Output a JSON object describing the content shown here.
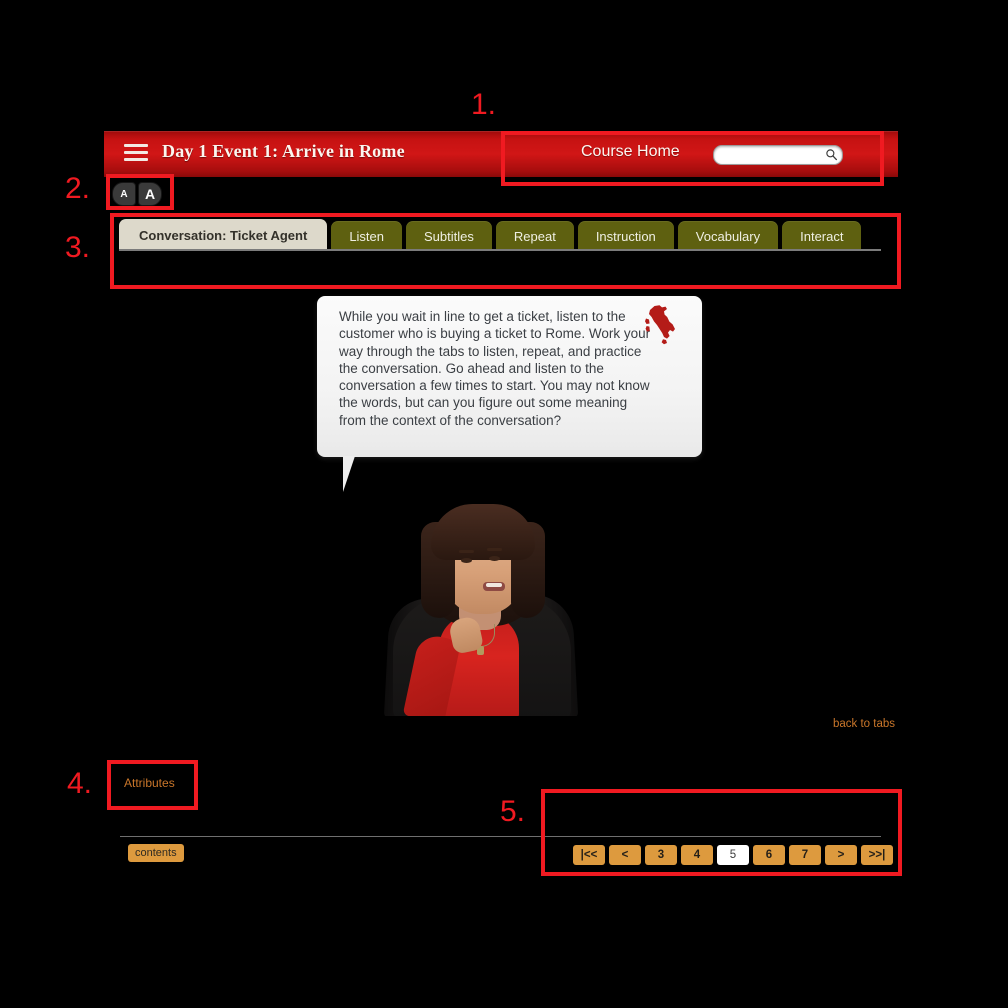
{
  "header": {
    "menu_icon": "hamburger-icon",
    "title": "Day 1 Event 1: Arrive in Rome",
    "course_home_label": "Course Home",
    "search": {
      "value": "",
      "placeholder": "",
      "icon": "search-icon"
    },
    "accent_red": "#c61212"
  },
  "font_size_controls": {
    "decrease_label": "A",
    "increase_label": "A"
  },
  "tabs": [
    {
      "label": "Conversation: Ticket Agent",
      "active": true
    },
    {
      "label": "Listen",
      "active": false
    },
    {
      "label": "Subtitles",
      "active": false
    },
    {
      "label": "Repeat",
      "active": false
    },
    {
      "label": "Instruction",
      "active": false
    },
    {
      "label": "Vocabulary",
      "active": false
    },
    {
      "label": "Interact",
      "active": false
    }
  ],
  "tab_colors": {
    "inactive_bg": "#5e6010",
    "active_bg": "#ddd9cb"
  },
  "bubble": {
    "text": "While you wait in line to get a ticket, listen to the customer who is buying a ticket to Rome. Work your way through the tabs to listen, repeat, and practice the conversation. Go ahead and listen to the conversation a few times to start. You may not know the words, but can you figure out some meaning from the context of the conversation?",
    "icon": "italy-map-icon",
    "icon_color": "#b41c18"
  },
  "presenter": {
    "alt": "woman presenter in red top and black cardigan"
  },
  "links": {
    "back_to_tabs": "back to tabs",
    "attributes": "Attributes",
    "contents": "contents",
    "link_color": "#c9762a"
  },
  "pagination": {
    "current": "5",
    "buttons": [
      {
        "label": "|<<",
        "current": false
      },
      {
        "label": "<",
        "current": false
      },
      {
        "label": "3",
        "current": false
      },
      {
        "label": "4",
        "current": false
      },
      {
        "label": "5",
        "current": true
      },
      {
        "label": "6",
        "current": false
      },
      {
        "label": "7",
        "current": false
      },
      {
        "label": ">",
        "current": false
      },
      {
        "label": ">>|",
        "current": false
      }
    ],
    "button_color": "#dd9a3e"
  },
  "annotations": {
    "color": "#f01a21",
    "numbers": [
      "1.",
      "2.",
      "3.",
      "4.",
      "5."
    ]
  }
}
